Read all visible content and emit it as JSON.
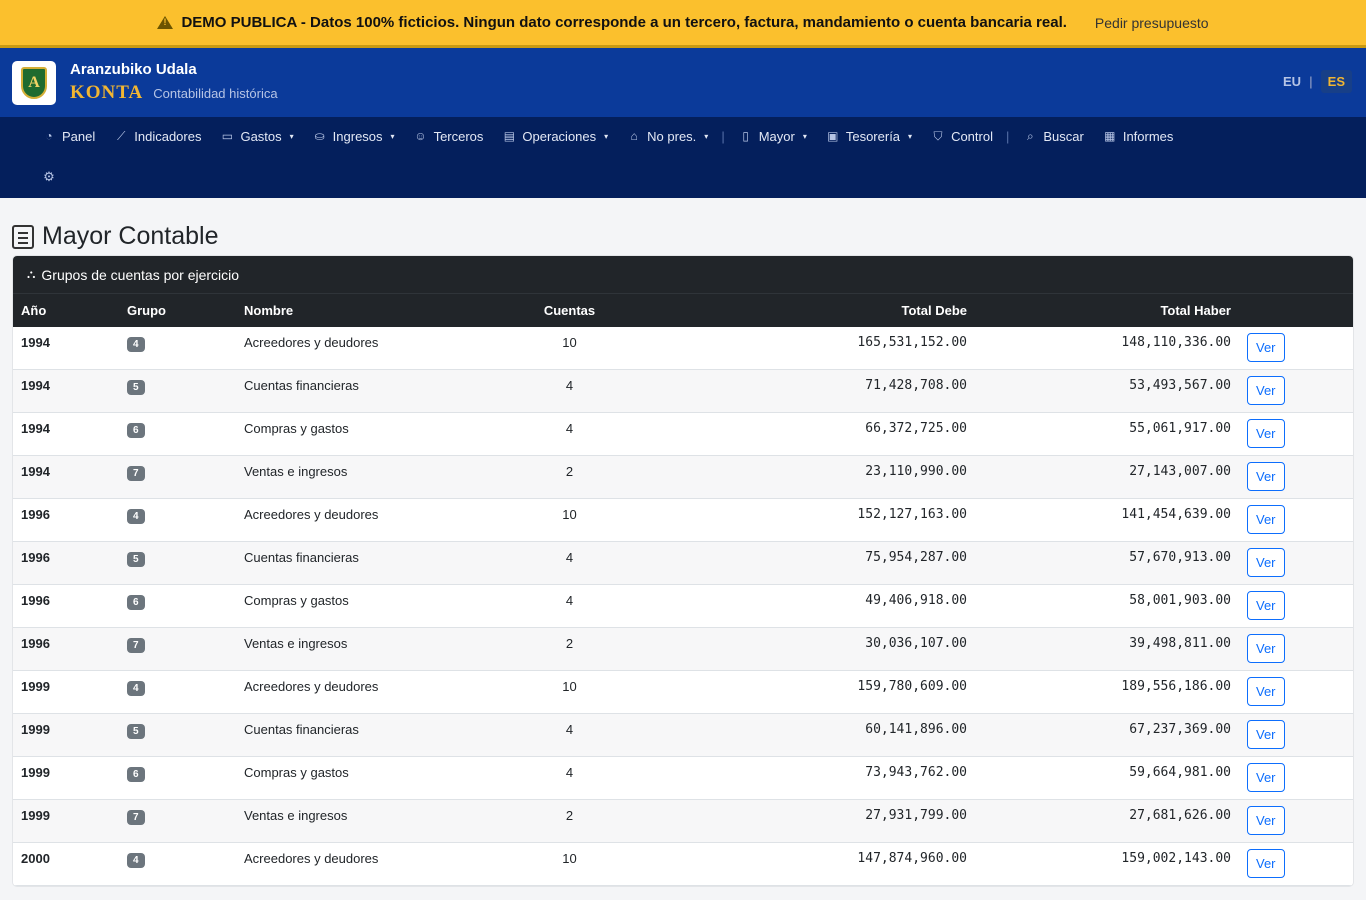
{
  "demo_banner": {
    "message": "DEMO PUBLICA - Datos 100% ficticios. Ningun dato corresponde a un tercero, factura, mandamiento o cuenta bancaria real.",
    "link": "Pedir presupuesto"
  },
  "brand": {
    "name": "Aranzubiko Udala",
    "product": "KONTA",
    "tagline": "Contabilidad histórica",
    "logo_letter": "A"
  },
  "language": {
    "eu": "EU",
    "separator": "|",
    "es": "ES"
  },
  "nav": {
    "items": [
      {
        "label": "Panel",
        "icon": "dashboard-icon",
        "glyph": "◔"
      },
      {
        "label": "Indicadores",
        "icon": "chart-line-icon",
        "glyph": "⟋"
      },
      {
        "label": "Gastos",
        "icon": "wallet-icon",
        "glyph": "▭",
        "dropdown": "▾"
      },
      {
        "label": "Ingresos",
        "icon": "coins-icon",
        "glyph": "⛀",
        "dropdown": "▾"
      },
      {
        "label": "Terceros",
        "icon": "people-icon",
        "glyph": "☺"
      },
      {
        "label": "Operaciones",
        "icon": "list-icon",
        "glyph": "▤",
        "dropdown": "▾"
      },
      {
        "label": "No pres.",
        "icon": "bank-icon",
        "glyph": "⌂",
        "dropdown": "▾"
      },
      {
        "label": "Mayor",
        "icon": "journal-icon",
        "glyph": "▯",
        "dropdown": "▾"
      },
      {
        "label": "Tesorería",
        "icon": "safe-icon",
        "glyph": "▣",
        "dropdown": "▾"
      },
      {
        "label": "Control",
        "icon": "shield-icon",
        "glyph": "⛉"
      },
      {
        "label": "Buscar",
        "icon": "search-icon",
        "glyph": "⌕"
      },
      {
        "label": "Informes",
        "icon": "report-icon",
        "glyph": "▦"
      }
    ],
    "separator": "|",
    "settings_glyph": "⚙"
  },
  "page": {
    "title": "Mayor Contable",
    "card_title": "Grupos de cuentas por ejercicio",
    "card_glyph": "⛬"
  },
  "table": {
    "headers": {
      "year": "Año",
      "group": "Grupo",
      "name": "Nombre",
      "accounts": "Cuentas",
      "debit": "Total Debe",
      "credit": "Total Haber"
    },
    "action_label": "Ver",
    "rows": [
      {
        "year": "1994",
        "group": "4",
        "name": "Acreedores y deudores",
        "accounts": "10",
        "debit": "165,531,152.00",
        "credit": "148,110,336.00"
      },
      {
        "year": "1994",
        "group": "5",
        "name": "Cuentas financieras",
        "accounts": "4",
        "debit": "71,428,708.00",
        "credit": "53,493,567.00"
      },
      {
        "year": "1994",
        "group": "6",
        "name": "Compras y gastos",
        "accounts": "4",
        "debit": "66,372,725.00",
        "credit": "55,061,917.00"
      },
      {
        "year": "1994",
        "group": "7",
        "name": "Ventas e ingresos",
        "accounts": "2",
        "debit": "23,110,990.00",
        "credit": "27,143,007.00"
      },
      {
        "year": "1996",
        "group": "4",
        "name": "Acreedores y deudores",
        "accounts": "10",
        "debit": "152,127,163.00",
        "credit": "141,454,639.00"
      },
      {
        "year": "1996",
        "group": "5",
        "name": "Cuentas financieras",
        "accounts": "4",
        "debit": "75,954,287.00",
        "credit": "57,670,913.00"
      },
      {
        "year": "1996",
        "group": "6",
        "name": "Compras y gastos",
        "accounts": "4",
        "debit": "49,406,918.00",
        "credit": "58,001,903.00"
      },
      {
        "year": "1996",
        "group": "7",
        "name": "Ventas e ingresos",
        "accounts": "2",
        "debit": "30,036,107.00",
        "credit": "39,498,811.00"
      },
      {
        "year": "1999",
        "group": "4",
        "name": "Acreedores y deudores",
        "accounts": "10",
        "debit": "159,780,609.00",
        "credit": "189,556,186.00"
      },
      {
        "year": "1999",
        "group": "5",
        "name": "Cuentas financieras",
        "accounts": "4",
        "debit": "60,141,896.00",
        "credit": "67,237,369.00"
      },
      {
        "year": "1999",
        "group": "6",
        "name": "Compras y gastos",
        "accounts": "4",
        "debit": "73,943,762.00",
        "credit": "59,664,981.00"
      },
      {
        "year": "1999",
        "group": "7",
        "name": "Ventas e ingresos",
        "accounts": "2",
        "debit": "27,931,799.00",
        "credit": "27,681,626.00"
      },
      {
        "year": "2000",
        "group": "4",
        "name": "Acreedores y deudores",
        "accounts": "10",
        "debit": "147,874,960.00",
        "credit": "159,002,143.00"
      }
    ]
  }
}
